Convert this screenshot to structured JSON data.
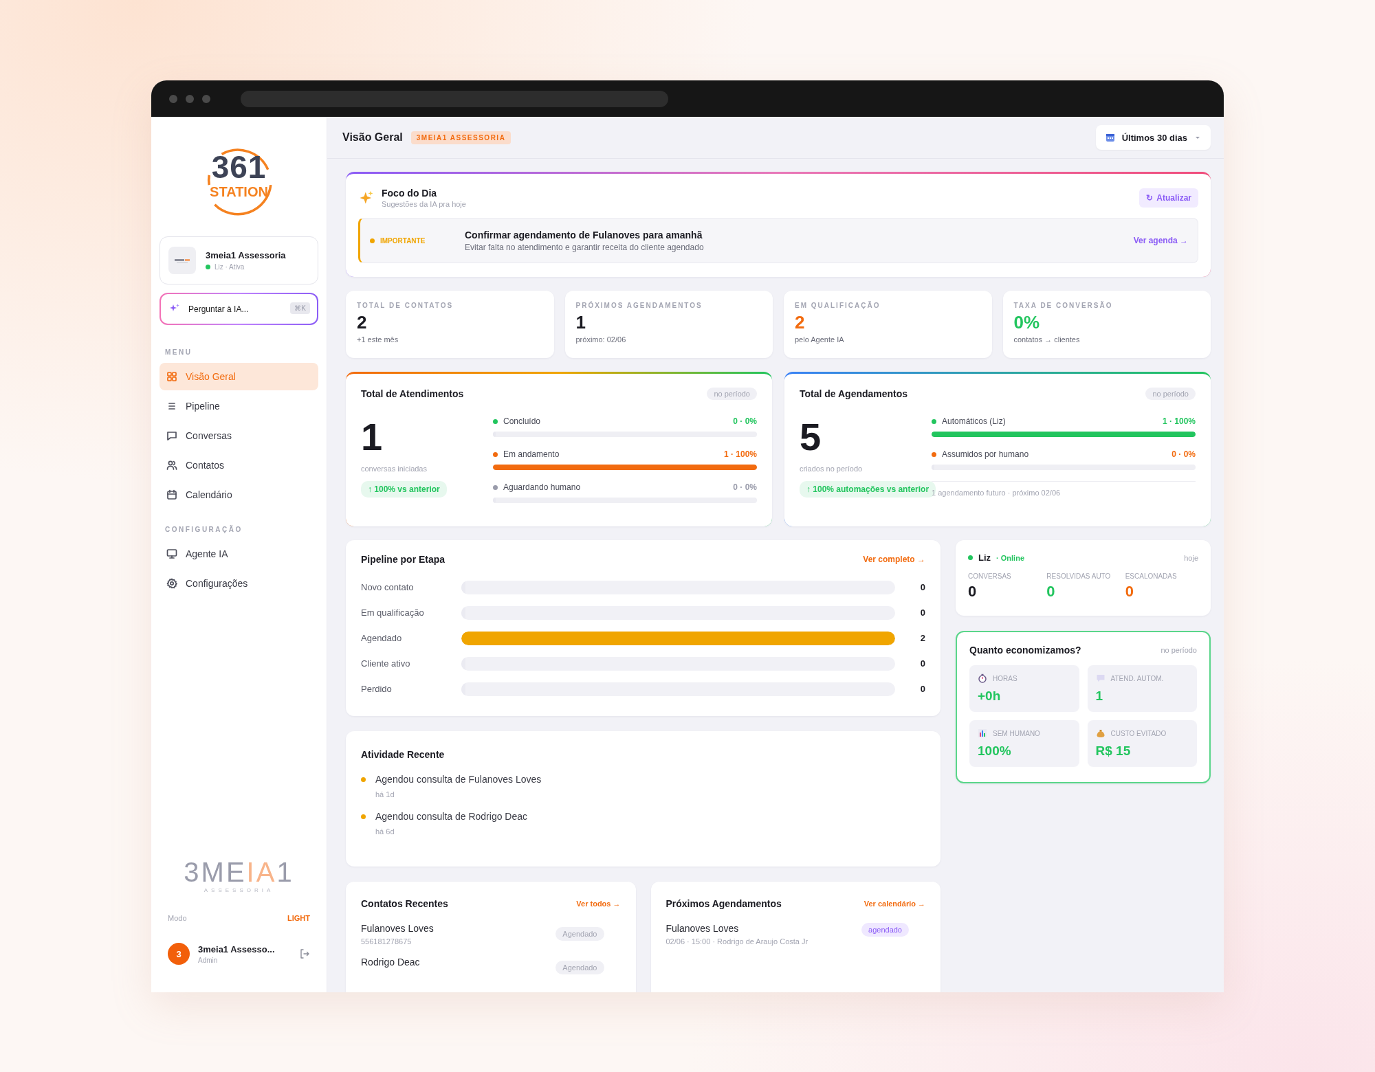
{
  "sidebar": {
    "logo": {
      "number": "361",
      "word": "STATION"
    },
    "account": {
      "name": "3meia1 Assessoria",
      "status": "Liz · Ativa",
      "online": true
    },
    "ask_ai": {
      "placeholder": "Perguntar à IA...",
      "shortcut": "⌘K"
    },
    "sections": [
      {
        "title": "MENU",
        "items": [
          {
            "label": "Visão Geral",
            "selected": true
          },
          {
            "label": "Pipeline",
            "selected": false
          },
          {
            "label": "Conversas",
            "selected": false
          },
          {
            "label": "Contatos",
            "selected": false
          },
          {
            "label": "Calendário",
            "selected": false
          }
        ]
      },
      {
        "title": "CONFIGURAÇÃO",
        "items": [
          {
            "label": "Agente IA",
            "selected": false
          },
          {
            "label": "Configurações",
            "selected": false
          }
        ]
      }
    ],
    "brand": {
      "name_start": "3ME",
      "name_accent": "IA",
      "name_end": "1",
      "tagline": "ASSESSORIA"
    },
    "mode": {
      "label": "Modo",
      "value": "LIGHT"
    },
    "user": {
      "initial": "3",
      "name": "3meia1 Assesso...",
      "role": "Admin"
    }
  },
  "header": {
    "title": "Visão Geral",
    "badge": "3MEIA1 ASSESSORIA",
    "date_range": "Últimos 30 dias"
  },
  "focus": {
    "title": "Foco do Dia",
    "subtitle": "Sugestões da IA pra hoje",
    "refresh_icon": "↻",
    "refresh": "Atualizar",
    "alert": {
      "priority": "IMPORTANTE",
      "title": "Confirmar agendamento de Fulanoves para amanhã",
      "detail": "Evitar falta no atendimento e garantir receita do cliente agendado",
      "link": "Ver agenda →"
    }
  },
  "stats": [
    {
      "label": "TOTAL DE CONTATOS",
      "value": "2",
      "note": "+1 este mês",
      "color": "#1b1b22"
    },
    {
      "label": "PRÓXIMOS AGENDAMENTOS",
      "value": "1",
      "note": "próximo: 02/06",
      "color": "#1b1b22"
    },
    {
      "label": "EM QUALIFICAÇÃO",
      "value": "2",
      "note": "pelo Agente IA",
      "color": "#f26b0f"
    },
    {
      "label": "TAXA DE CONVERSÃO",
      "value": "0%",
      "note": "contatos → clientes",
      "color": "#22c55e"
    }
  ],
  "totals": [
    {
      "title": "Total de Atendimentos",
      "period": "no período",
      "value": "1",
      "caption": "conversas iniciadas",
      "trend": "↑ 100% vs anterior",
      "rows": [
        {
          "label": "Concluído",
          "reading": "0 · 0%",
          "color": "#22c55e",
          "level": 0
        },
        {
          "label": "Em andamento",
          "reading": "1 · 100%",
          "color": "#f26b0f",
          "level": 1
        },
        {
          "label": "Aguardando humano",
          "reading": "0 · 0%",
          "color": "#9a9cab",
          "level": 0
        }
      ]
    },
    {
      "title": "Total de Agendamentos",
      "period": "no período",
      "value": "5",
      "caption": "criados no período",
      "trend": "↑ 100% automações vs anterior",
      "rows": [
        {
          "label": "Automáticos (Liz)",
          "reading": "1 · 100%",
          "color": "#22c55e",
          "level": 1
        },
        {
          "label": "Assumidos por humano",
          "reading": "0 · 0%",
          "color": "#f26b0f",
          "level": 0
        }
      ],
      "footnote": "1 agendamento futuro · próximo 02/06"
    }
  ],
  "pipeline": {
    "title": "Pipeline por Etapa",
    "link": "Ver completo →",
    "stages": [
      {
        "label": "Novo contato",
        "count": "0",
        "level": 0
      },
      {
        "label": "Em qualificação",
        "count": "0",
        "level": 0
      },
      {
        "label": "Agendado",
        "count": "2",
        "level": 1
      },
      {
        "label": "Cliente ativo",
        "count": "0",
        "level": 0
      },
      {
        "label": "Perdido",
        "count": "0",
        "level": 0
      }
    ]
  },
  "liz": {
    "name": "Liz",
    "status": "· Online",
    "online": true,
    "when": "hoje",
    "metrics": [
      {
        "label": "CONVERSAS",
        "value": "0",
        "color": "#1b1b22"
      },
      {
        "label": "RESOLVIDAS AUTO",
        "value": "0",
        "color": "#22c55e"
      },
      {
        "label": "ESCALONADAS",
        "value": "0",
        "color": "#f26b0f"
      }
    ]
  },
  "savings": {
    "title": "Quanto economizamos?",
    "period": "no período",
    "tiles": [
      {
        "label": "HORAS",
        "value": "+0h"
      },
      {
        "label": "ATEND. AUTOM.",
        "value": "1"
      },
      {
        "label": "SEM HUMANO",
        "value": "100%"
      },
      {
        "label": "CUSTO EVITADO",
        "value": "R$ 15"
      }
    ]
  },
  "activity": {
    "title": "Atividade Recente",
    "items": [
      {
        "text": "Agendou consulta de Fulanoves Loves",
        "time": "há 1d"
      },
      {
        "text": "Agendou consulta de Rodrigo Deac",
        "time": "há 6d"
      }
    ]
  },
  "contacts": {
    "title": "Contatos Recentes",
    "link": "Ver todos →",
    "rows": [
      {
        "name": "Fulanoves Loves",
        "phone": "556181278675",
        "status": "Agendado"
      },
      {
        "name": "Rodrigo Deac",
        "status": "Agendado"
      }
    ]
  },
  "appointments": {
    "title": "Próximos Agendamentos",
    "link": "Ver calendário →",
    "rows": [
      {
        "name": "Fulanoves Loves",
        "detail": "02/06 · 15:00 · Rodrigo de Araujo Costa Jr",
        "status": "agendado"
      }
    ]
  }
}
